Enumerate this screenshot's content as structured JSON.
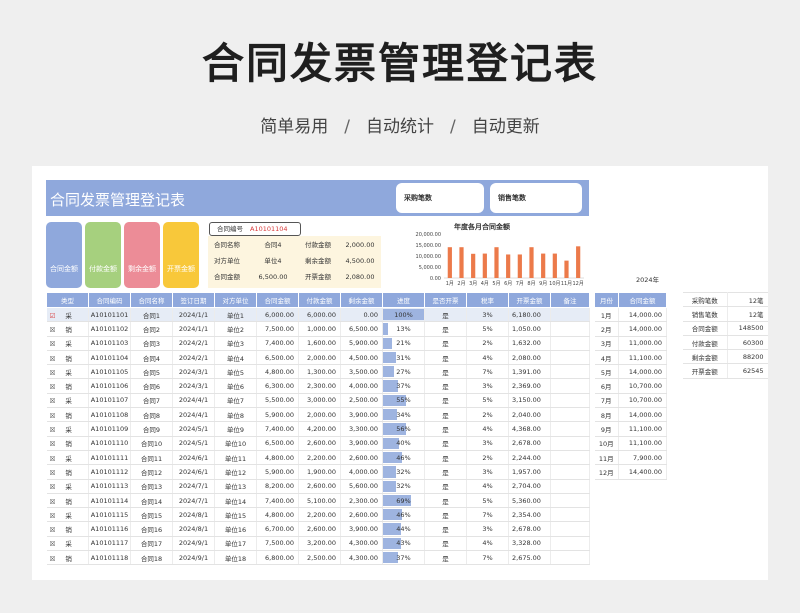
{
  "hero": {
    "title": "合同发票管理登记表",
    "tags": [
      "简单易用",
      "自动统计",
      "自动更新"
    ],
    "sep": "/"
  },
  "sheet": {
    "banner_title": "合同发票管理登记表",
    "stats": {
      "purchase_label": "采购笔数",
      "sales_label": "销售笔数"
    },
    "cards": [
      {
        "label": "合同金额",
        "color": "#8fa8dc"
      },
      {
        "label": "付款金额",
        "color": "#a6d07e"
      },
      {
        "label": "剩余金额",
        "color": "#ec8c97"
      },
      {
        "label": "开票金额",
        "color": "#f8c83a"
      }
    ],
    "contract": {
      "label": "合同编号",
      "value": "A10101104"
    },
    "info": {
      "rows": [
        [
          "合同名称",
          "合同4",
          "付款金额",
          "2,000.00"
        ],
        [
          "对方单位",
          "单位4",
          "剩余金额",
          "4,500.00"
        ],
        [
          "合同金额",
          "6,500.00",
          "开票金额",
          "2,080.00"
        ]
      ]
    }
  },
  "chart_data": {
    "type": "bar",
    "title": "年度各月合同金额",
    "categories": [
      "1月",
      "2月",
      "3月",
      "4月",
      "5月",
      "6月",
      "7月",
      "8月",
      "9月",
      "10月",
      "11月",
      "12月"
    ],
    "values": [
      14000,
      14000,
      11000,
      11100,
      14000,
      10700,
      10700,
      14000,
      11100,
      11100,
      7900,
      14400
    ],
    "ylim": [
      0,
      20000
    ],
    "yticks": [
      "0.00",
      "5,000.00",
      "10,000.00",
      "15,000.00",
      "20,000.00"
    ],
    "color": "#ec7a4a"
  },
  "main_table": {
    "headers": [
      "类型",
      "合同编码",
      "合同名称",
      "签订日期",
      "对方单位",
      "合同金额",
      "付款金额",
      "剩余金额",
      "进度",
      "是否开票",
      "税率",
      "开票金额",
      "备注"
    ],
    "rows": [
      [
        "采",
        "A10101101",
        "合同1",
        "2024/1/1",
        "单位1",
        "6,000.00",
        "6,000.00",
        "0.00",
        "100%",
        "是",
        "3%",
        "6,180.00",
        ""
      ],
      [
        "销",
        "A10101102",
        "合同2",
        "2024/1/1",
        "单位2",
        "7,500.00",
        "1,000.00",
        "6,500.00",
        "13%",
        "是",
        "5%",
        "1,050.00",
        ""
      ],
      [
        "采",
        "A10101103",
        "合同3",
        "2024/2/1",
        "单位3",
        "7,400.00",
        "1,600.00",
        "5,900.00",
        "21%",
        "是",
        "2%",
        "1,632.00",
        ""
      ],
      [
        "销",
        "A10101104",
        "合同4",
        "2024/2/1",
        "单位4",
        "6,500.00",
        "2,000.00",
        "4,500.00",
        "31%",
        "是",
        "4%",
        "2,080.00",
        ""
      ],
      [
        "采",
        "A10101105",
        "合同5",
        "2024/3/1",
        "单位5",
        "4,800.00",
        "1,300.00",
        "3,500.00",
        "27%",
        "是",
        "7%",
        "1,391.00",
        ""
      ],
      [
        "销",
        "A10101106",
        "合同6",
        "2024/3/1",
        "单位6",
        "6,300.00",
        "2,300.00",
        "4,000.00",
        "37%",
        "是",
        "3%",
        "2,369.00",
        ""
      ],
      [
        "采",
        "A10101107",
        "合同7",
        "2024/4/1",
        "单位7",
        "5,500.00",
        "3,000.00",
        "2,500.00",
        "55%",
        "是",
        "5%",
        "3,150.00",
        ""
      ],
      [
        "销",
        "A10101108",
        "合同8",
        "2024/4/1",
        "单位8",
        "5,900.00",
        "2,000.00",
        "3,900.00",
        "34%",
        "是",
        "2%",
        "2,040.00",
        ""
      ],
      [
        "采",
        "A10101109",
        "合同9",
        "2024/5/1",
        "单位9",
        "7,400.00",
        "4,200.00",
        "3,300.00",
        "56%",
        "是",
        "4%",
        "4,368.00",
        ""
      ],
      [
        "销",
        "A10101110",
        "合同10",
        "2024/5/1",
        "单位10",
        "6,500.00",
        "2,600.00",
        "3,900.00",
        "40%",
        "是",
        "3%",
        "2,678.00",
        ""
      ],
      [
        "采",
        "A10101111",
        "合同11",
        "2024/6/1",
        "单位11",
        "4,800.00",
        "2,200.00",
        "2,600.00",
        "46%",
        "是",
        "2%",
        "2,244.00",
        ""
      ],
      [
        "销",
        "A10101112",
        "合同12",
        "2024/6/1",
        "单位12",
        "5,900.00",
        "1,900.00",
        "4,000.00",
        "32%",
        "是",
        "3%",
        "1,957.00",
        ""
      ],
      [
        "采",
        "A10101113",
        "合同13",
        "2024/7/1",
        "单位13",
        "8,200.00",
        "2,600.00",
        "5,600.00",
        "32%",
        "是",
        "4%",
        "2,704.00",
        ""
      ],
      [
        "销",
        "A10101114",
        "合同14",
        "2024/7/1",
        "单位14",
        "7,400.00",
        "5,100.00",
        "2,300.00",
        "69%",
        "是",
        "5%",
        "5,360.00",
        ""
      ],
      [
        "采",
        "A10101115",
        "合同15",
        "2024/8/1",
        "单位15",
        "4,800.00",
        "2,200.00",
        "2,600.00",
        "46%",
        "是",
        "7%",
        "2,354.00",
        ""
      ],
      [
        "销",
        "A10101116",
        "合同16",
        "2024/8/1",
        "单位16",
        "6,700.00",
        "2,600.00",
        "3,900.00",
        "44%",
        "是",
        "3%",
        "2,678.00",
        ""
      ],
      [
        "采",
        "A10101117",
        "合同17",
        "2024/9/1",
        "单位17",
        "7,500.00",
        "3,200.00",
        "4,300.00",
        "43%",
        "是",
        "4%",
        "3,328.00",
        ""
      ],
      [
        "销",
        "A10101118",
        "合同18",
        "2024/9/1",
        "单位18",
        "6,800.00",
        "2,500.00",
        "4,300.00",
        "37%",
        "是",
        "7%",
        "2,675.00",
        ""
      ]
    ]
  },
  "month_table": {
    "year": "2024年",
    "headers": [
      "月份",
      "合同金额"
    ],
    "rows": [
      [
        "1月",
        "14,000.00"
      ],
      [
        "2月",
        "14,000.00"
      ],
      [
        "3月",
        "11,000.00"
      ],
      [
        "4月",
        "11,100.00"
      ],
      [
        "5月",
        "14,000.00"
      ],
      [
        "6月",
        "10,700.00"
      ],
      [
        "7月",
        "10,700.00"
      ],
      [
        "8月",
        "14,000.00"
      ],
      [
        "9月",
        "11,100.00"
      ],
      [
        "10月",
        "11,100.00"
      ],
      [
        "11月",
        "7,900.00"
      ],
      [
        "12月",
        "14,400.00"
      ]
    ]
  },
  "summary_table": {
    "rows": [
      [
        "采购笔数",
        "12笔"
      ],
      [
        "销售笔数",
        "12笔"
      ],
      [
        "合同金额",
        "148500"
      ],
      [
        "付款金额",
        "60300"
      ],
      [
        "剩余金额",
        "88200"
      ],
      [
        "开票金额",
        "62545"
      ]
    ]
  },
  "colors": {
    "accent": "#8fa8dc",
    "bar": "#ec7a4a",
    "selected_row": "#e6ecf6",
    "check_red": "#d93a3a"
  }
}
